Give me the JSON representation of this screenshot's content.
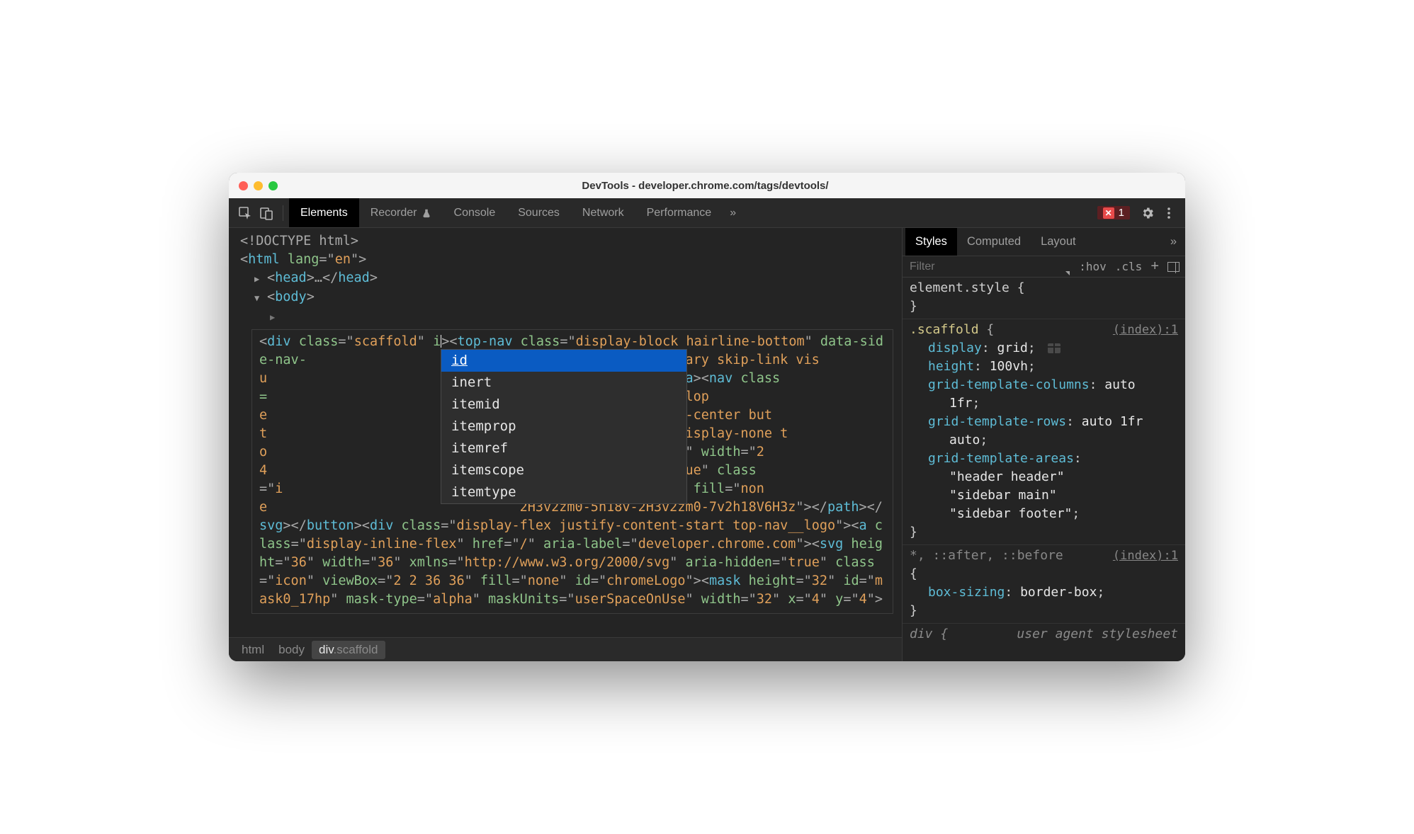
{
  "window": {
    "title": "DevTools - developer.chrome.com/tags/devtools/"
  },
  "toolbar": {
    "tabs": [
      "Elements",
      "Recorder",
      "Console",
      "Sources",
      "Network",
      "Performance"
    ],
    "active_tab_index": 0,
    "errors_count": "1",
    "more_glyph": "»"
  },
  "dom": {
    "doctype": "<!DOCTYPE html>",
    "lines": {
      "html_open_pre": "<",
      "html_tag": "html",
      "html_attr": " lang",
      "html_eq": "=\"",
      "html_val": "en",
      "html_close": "\">",
      "head_pre": "<",
      "head_tag": "head",
      "head_mid": ">",
      "head_ell": "…",
      "head_post": "</",
      "head_tag2": "head",
      "head_end": ">",
      "body_pre": "<",
      "body_tag": "body",
      "body_end": ">"
    },
    "editing_attr_prefix": "i",
    "autocomplete": {
      "options": [
        "id",
        "inert",
        "itemid",
        "itemprop",
        "itemref",
        "itemscope",
        "itemtype"
      ],
      "selected_index": 0
    }
  },
  "breadcrumbs": {
    "items": [
      "html",
      "body"
    ],
    "selected": {
      "tag": "div",
      "class": ".scaffold"
    }
  },
  "sidebar": {
    "tabs": [
      "Styles",
      "Computed",
      "Layout"
    ],
    "active_tab_index": 0,
    "filter_placeholder": "Filter",
    "hov": ":hov",
    "cls": ".cls",
    "element_style_label": "element.style {",
    "rules": [
      {
        "selector": ".scaffold",
        "source": "(index):1",
        "props": [
          {
            "name": "display",
            "value": "grid",
            "grid_icon": true
          },
          {
            "name": "height",
            "value": "100vh"
          },
          {
            "name": "grid-template-columns",
            "value": "auto",
            "cont": "1fr"
          },
          {
            "name": "grid-template-rows",
            "value": "auto 1fr",
            "cont": "auto"
          },
          {
            "name": "grid-template-areas",
            "lines": [
              "\"header header\"",
              "\"sidebar main\"",
              "\"sidebar footer\""
            ]
          }
        ]
      },
      {
        "selector": "*, ::after, ::before",
        "source": "(index):1",
        "props": [
          {
            "name": "box-sizing",
            "value": "border-box"
          }
        ]
      }
    ],
    "ua_rule": {
      "selector": "div {",
      "label": "user agent stylesheet"
    }
  }
}
